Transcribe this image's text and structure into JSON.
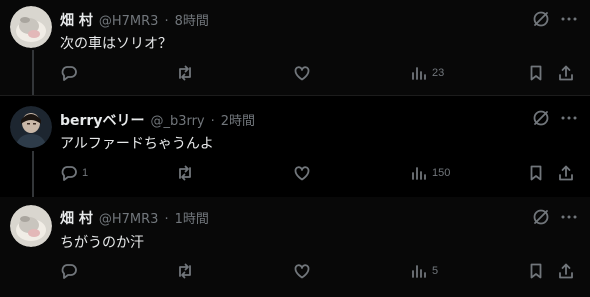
{
  "tweets": [
    {
      "display_name": "畑 村",
      "handle": "@H7MR3",
      "time": "8時間",
      "text": "次の車はソリオ？",
      "views": "23"
    },
    {
      "display_name": "berryベリー",
      "handle": "@_b3rry",
      "time": "2時間",
      "text": "アルファードちゃうんよ",
      "replies": "1",
      "views": "150"
    },
    {
      "display_name": "畑 村",
      "handle": "@H7MR3",
      "time": "1時間",
      "text": "ちがうのか汗",
      "views": "5"
    }
  ],
  "separator": "·",
  "colors": {
    "text": "#e7e9ea",
    "muted": "#71767b",
    "background": "#000000",
    "thread_line": "#333639"
  },
  "icons": [
    "grok-icon",
    "more-icon",
    "reply-icon",
    "retweet-icon",
    "like-icon",
    "views-icon",
    "bookmark-icon",
    "share-icon"
  ]
}
